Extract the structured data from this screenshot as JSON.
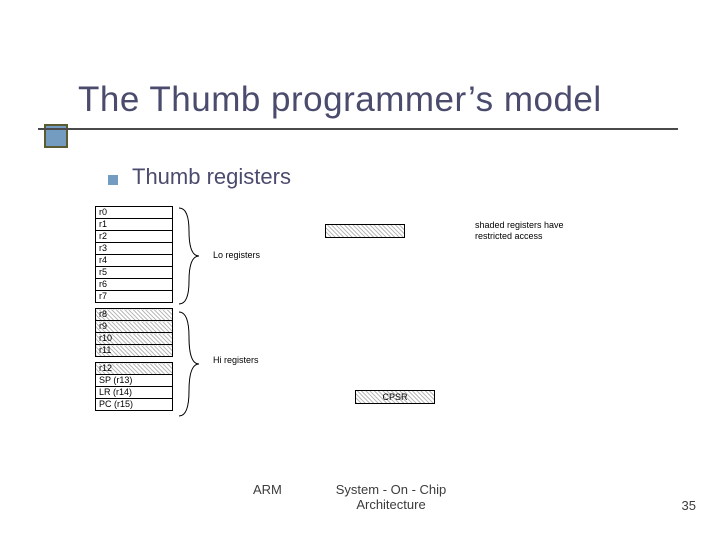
{
  "title": "The Thumb programmer’s model",
  "bullet": "Thumb registers",
  "registers": {
    "lo": [
      "r0",
      "r1",
      "r2",
      "r3",
      "r4",
      "r5",
      "r6",
      "r7"
    ],
    "hi": [
      "r8",
      "r9",
      "r10",
      "r11",
      "r12"
    ],
    "sp": "SP (r13)",
    "lr": "LR (r14)",
    "pc": "PC (r15)"
  },
  "labels": {
    "lo": "Lo registers",
    "hi": "Hi registers",
    "cpsr": "CPSR",
    "legend1": "shaded registers have",
    "legend2": "restricted access"
  },
  "footer": {
    "arm": "ARM",
    "center1": "System - On - Chip",
    "center2": "Architecture",
    "page": "35"
  }
}
